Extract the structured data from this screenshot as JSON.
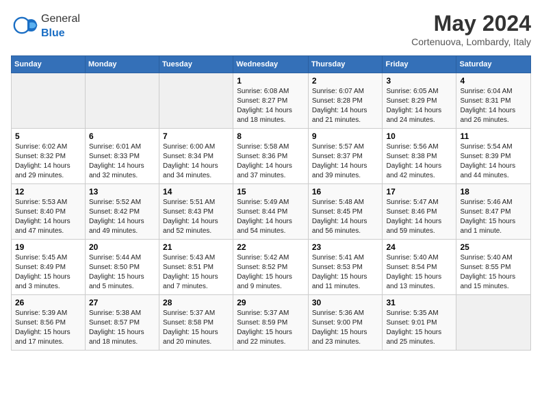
{
  "logo": {
    "general": "General",
    "blue": "Blue",
    "icon_color": "#1a6ec4"
  },
  "header": {
    "month": "May 2024",
    "location": "Cortenuova, Lombardy, Italy"
  },
  "weekdays": [
    "Sunday",
    "Monday",
    "Tuesday",
    "Wednesday",
    "Thursday",
    "Friday",
    "Saturday"
  ],
  "weeks": [
    [
      {
        "day": "",
        "info": ""
      },
      {
        "day": "",
        "info": ""
      },
      {
        "day": "",
        "info": ""
      },
      {
        "day": "1",
        "info": "Sunrise: 6:08 AM\nSunset: 8:27 PM\nDaylight: 14 hours\nand 18 minutes."
      },
      {
        "day": "2",
        "info": "Sunrise: 6:07 AM\nSunset: 8:28 PM\nDaylight: 14 hours\nand 21 minutes."
      },
      {
        "day": "3",
        "info": "Sunrise: 6:05 AM\nSunset: 8:29 PM\nDaylight: 14 hours\nand 24 minutes."
      },
      {
        "day": "4",
        "info": "Sunrise: 6:04 AM\nSunset: 8:31 PM\nDaylight: 14 hours\nand 26 minutes."
      }
    ],
    [
      {
        "day": "5",
        "info": "Sunrise: 6:02 AM\nSunset: 8:32 PM\nDaylight: 14 hours\nand 29 minutes."
      },
      {
        "day": "6",
        "info": "Sunrise: 6:01 AM\nSunset: 8:33 PM\nDaylight: 14 hours\nand 32 minutes."
      },
      {
        "day": "7",
        "info": "Sunrise: 6:00 AM\nSunset: 8:34 PM\nDaylight: 14 hours\nand 34 minutes."
      },
      {
        "day": "8",
        "info": "Sunrise: 5:58 AM\nSunset: 8:36 PM\nDaylight: 14 hours\nand 37 minutes."
      },
      {
        "day": "9",
        "info": "Sunrise: 5:57 AM\nSunset: 8:37 PM\nDaylight: 14 hours\nand 39 minutes."
      },
      {
        "day": "10",
        "info": "Sunrise: 5:56 AM\nSunset: 8:38 PM\nDaylight: 14 hours\nand 42 minutes."
      },
      {
        "day": "11",
        "info": "Sunrise: 5:54 AM\nSunset: 8:39 PM\nDaylight: 14 hours\nand 44 minutes."
      }
    ],
    [
      {
        "day": "12",
        "info": "Sunrise: 5:53 AM\nSunset: 8:40 PM\nDaylight: 14 hours\nand 47 minutes."
      },
      {
        "day": "13",
        "info": "Sunrise: 5:52 AM\nSunset: 8:42 PM\nDaylight: 14 hours\nand 49 minutes."
      },
      {
        "day": "14",
        "info": "Sunrise: 5:51 AM\nSunset: 8:43 PM\nDaylight: 14 hours\nand 52 minutes."
      },
      {
        "day": "15",
        "info": "Sunrise: 5:49 AM\nSunset: 8:44 PM\nDaylight: 14 hours\nand 54 minutes."
      },
      {
        "day": "16",
        "info": "Sunrise: 5:48 AM\nSunset: 8:45 PM\nDaylight: 14 hours\nand 56 minutes."
      },
      {
        "day": "17",
        "info": "Sunrise: 5:47 AM\nSunset: 8:46 PM\nDaylight: 14 hours\nand 59 minutes."
      },
      {
        "day": "18",
        "info": "Sunrise: 5:46 AM\nSunset: 8:47 PM\nDaylight: 15 hours\nand 1 minute."
      }
    ],
    [
      {
        "day": "19",
        "info": "Sunrise: 5:45 AM\nSunset: 8:49 PM\nDaylight: 15 hours\nand 3 minutes."
      },
      {
        "day": "20",
        "info": "Sunrise: 5:44 AM\nSunset: 8:50 PM\nDaylight: 15 hours\nand 5 minutes."
      },
      {
        "day": "21",
        "info": "Sunrise: 5:43 AM\nSunset: 8:51 PM\nDaylight: 15 hours\nand 7 minutes."
      },
      {
        "day": "22",
        "info": "Sunrise: 5:42 AM\nSunset: 8:52 PM\nDaylight: 15 hours\nand 9 minutes."
      },
      {
        "day": "23",
        "info": "Sunrise: 5:41 AM\nSunset: 8:53 PM\nDaylight: 15 hours\nand 11 minutes."
      },
      {
        "day": "24",
        "info": "Sunrise: 5:40 AM\nSunset: 8:54 PM\nDaylight: 15 hours\nand 13 minutes."
      },
      {
        "day": "25",
        "info": "Sunrise: 5:40 AM\nSunset: 8:55 PM\nDaylight: 15 hours\nand 15 minutes."
      }
    ],
    [
      {
        "day": "26",
        "info": "Sunrise: 5:39 AM\nSunset: 8:56 PM\nDaylight: 15 hours\nand 17 minutes."
      },
      {
        "day": "27",
        "info": "Sunrise: 5:38 AM\nSunset: 8:57 PM\nDaylight: 15 hours\nand 18 minutes."
      },
      {
        "day": "28",
        "info": "Sunrise: 5:37 AM\nSunset: 8:58 PM\nDaylight: 15 hours\nand 20 minutes."
      },
      {
        "day": "29",
        "info": "Sunrise: 5:37 AM\nSunset: 8:59 PM\nDaylight: 15 hours\nand 22 minutes."
      },
      {
        "day": "30",
        "info": "Sunrise: 5:36 AM\nSunset: 9:00 PM\nDaylight: 15 hours\nand 23 minutes."
      },
      {
        "day": "31",
        "info": "Sunrise: 5:35 AM\nSunset: 9:01 PM\nDaylight: 15 hours\nand 25 minutes."
      },
      {
        "day": "",
        "info": ""
      }
    ]
  ]
}
